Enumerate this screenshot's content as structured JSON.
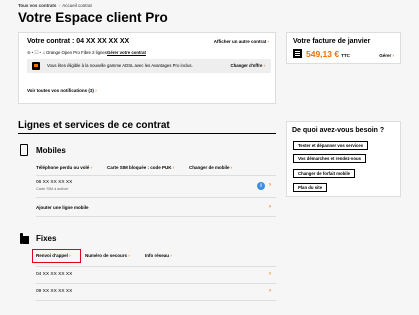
{
  "breadcrumb": {
    "home": "Tous vos contrats",
    "separator": "›",
    "current": "Accueil contrat"
  },
  "page_title": "Votre Espace client Pro",
  "contract": {
    "title": "Votre contrat : 04 XX XX XX XX",
    "other_link": "Afficher un autre contrat",
    "icons_text": "⊕ • ☐ • ♫",
    "offer": "Orange Open Pro Fibre 2 lignes",
    "manage": "Gérer votre contrat",
    "notification_text": "Vous êtes éligible à la nouvelle gamme ADSL avec les Avantages Pro inclus.",
    "notification_link": "Changer d'offre",
    "all_notifications": "Voir toutes vos notifications (3)"
  },
  "invoice": {
    "title": "Votre facture de janvier",
    "amount": "549,13 €",
    "suffix": "TTC",
    "manage": "Gérer"
  },
  "section_title": "Lignes et services de ce contrat",
  "mobiles": {
    "title": "Mobiles",
    "actions": [
      "Téléphone perdu ou volé",
      "Carte SIM bloquée : code PUK",
      "Changer de mobile"
    ],
    "line": {
      "number": "06 XX XX XX XX",
      "sub": "Carte SIM à activer"
    },
    "add_line": "Ajouter une ligne mobile"
  },
  "fixes": {
    "title": "Fixes",
    "actions": [
      "Renvoi d'appel",
      "Numéro de secours",
      "Info réseau"
    ],
    "lines": [
      "04 XX XX XX XX",
      "09 XX XX XX XX"
    ]
  },
  "help": {
    "title": "De quoi avez-vous besoin ?",
    "buttons": [
      "Tester et dépanner vos services",
      "Vos démarches et rendez-vous",
      "Changer de forfait mobile",
      "Plan du site"
    ]
  },
  "chevron": "›",
  "info_glyph": "i",
  "colors": {
    "brand": "#f16e00",
    "highlight": "#e2001a",
    "info": "#3d8fe0"
  }
}
